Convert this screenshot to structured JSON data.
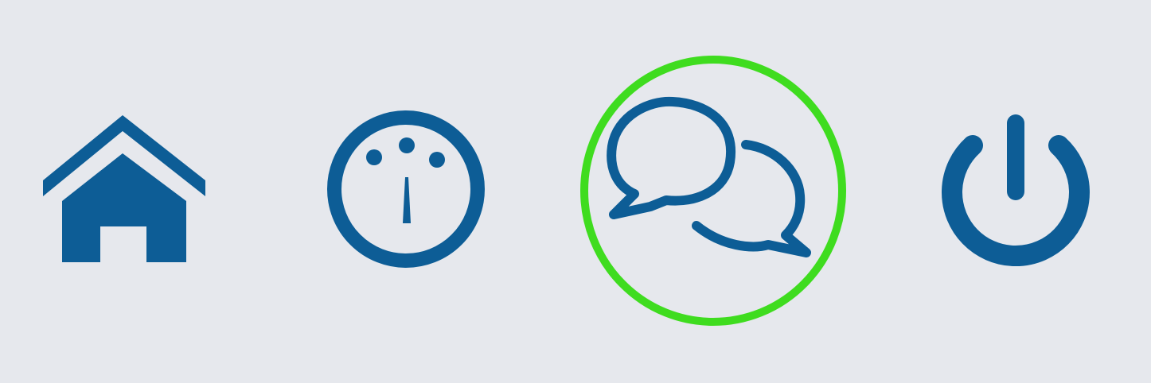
{
  "colors": {
    "background": "#e6e8ed",
    "icon": "#0d5d96",
    "highlight_ring": "#3fdc1f"
  },
  "toolbar": {
    "items": [
      {
        "icon": "home-icon",
        "selected": false
      },
      {
        "icon": "gauge-icon",
        "selected": false
      },
      {
        "icon": "chat-bubbles-icon",
        "selected": true
      },
      {
        "icon": "power-icon",
        "selected": false
      }
    ]
  }
}
